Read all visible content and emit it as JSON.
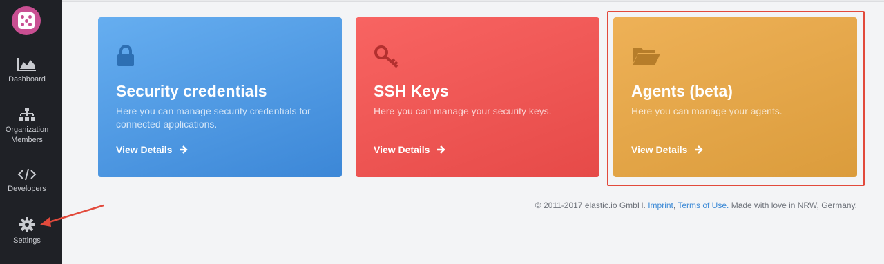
{
  "sidebar": {
    "logo_icon": "dice-logo-icon",
    "items": [
      {
        "label": "Dashboard",
        "icon": "area-chart-icon"
      },
      {
        "label": "Organization Members",
        "icon": "sitemap-icon"
      },
      {
        "label": "Developers",
        "icon": "code-icon"
      },
      {
        "label": "Settings",
        "icon": "gear-icon"
      }
    ]
  },
  "cards": [
    {
      "title": "Security credentials",
      "description": "Here you can manage security credentials for connected applications.",
      "link": "View Details",
      "icon": "lock-icon",
      "color": "#4f9ae3"
    },
    {
      "title": "SSH Keys",
      "description": "Here you can manage your security keys.",
      "link": "View Details",
      "icon": "key-icon",
      "color": "#ef5755"
    },
    {
      "title": "Agents (beta)",
      "description": "Here you can manage your agents.",
      "link": "View Details",
      "icon": "folder-open-icon",
      "color": "#e3a648"
    }
  ],
  "footer": {
    "copyright": "© 2011-2017 elastic.io GmbH.",
    "imprint": "Imprint",
    "separator": ",",
    "terms": "Terms of Use.",
    "tail": "Made with love in NRW, Germany."
  },
  "colors": {
    "sidebar_bg": "#1f2126",
    "highlight": "#e24a3c",
    "link": "#3d8ad6"
  }
}
